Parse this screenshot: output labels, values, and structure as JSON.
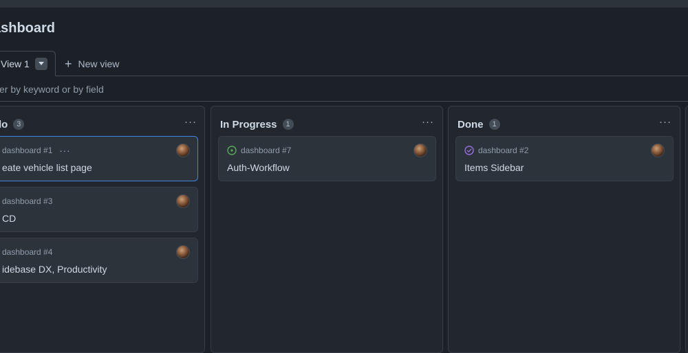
{
  "page": {
    "title": "ashboard"
  },
  "tabs": {
    "active_label": "View 1",
    "new_view_label": "New view"
  },
  "filter": {
    "placeholder": "lter by keyword or by field"
  },
  "colors": {
    "background": "#1c2128",
    "column_bg": "#22272e",
    "card_bg": "#2d333b",
    "selected_border": "#4184e4",
    "open_status": "#57ab5a",
    "done_status": "#986ee2"
  },
  "columns": [
    {
      "name": "lo",
      "count": "3",
      "menu": "···",
      "cards": [
        {
          "meta": "dashboard #1",
          "title": "eate vehicle list page",
          "status_icon": "none",
          "has_menu": true,
          "selected": true
        },
        {
          "meta": "dashboard #3",
          "title": "CD",
          "status_icon": "none"
        },
        {
          "meta": "dashboard #4",
          "title": "idebase DX, Productivity",
          "status_icon": "none"
        }
      ]
    },
    {
      "name": "In Progress",
      "count": "1",
      "menu": "···",
      "cards": [
        {
          "meta": "dashboard #7",
          "title": "Auth-Workflow",
          "status_icon": "open-issue-icon"
        }
      ]
    },
    {
      "name": "Done",
      "count": "1",
      "menu": "···",
      "cards": [
        {
          "meta": "dashboard #2",
          "title": "Items Sidebar",
          "status_icon": "closed-issue-icon"
        }
      ]
    }
  ],
  "card_menu_glyph": "···"
}
